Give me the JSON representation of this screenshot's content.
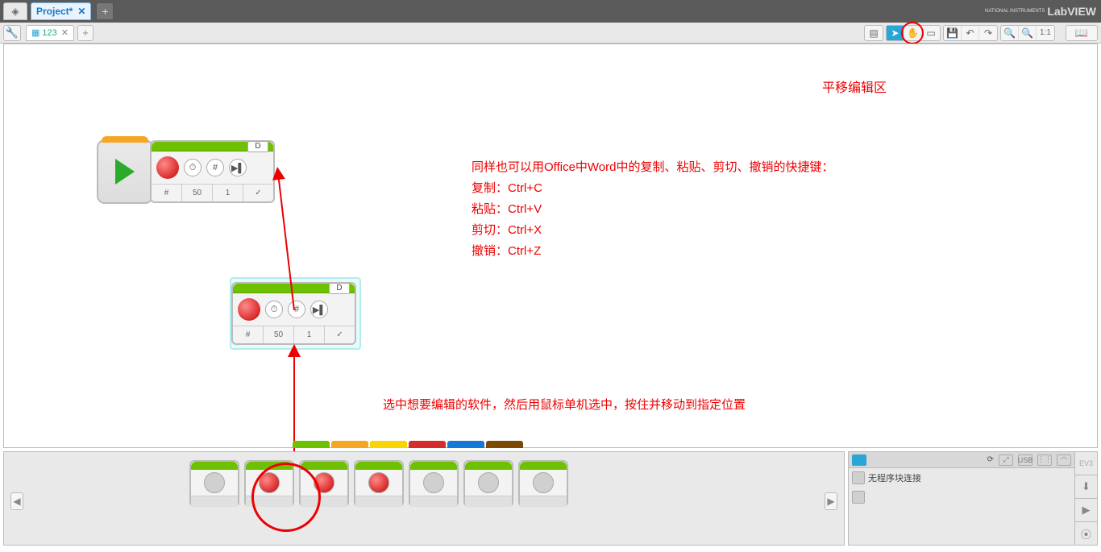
{
  "top": {
    "project_tab": "Project*",
    "brand_small": "NATIONAL INSTRUMENTS",
    "brand": "LabVIEW"
  },
  "toolbar": {
    "file_tab": "123",
    "ratio": "1:1"
  },
  "block_main": {
    "port": "D",
    "v1": "50",
    "v2": "1"
  },
  "block_sel": {
    "port": "D",
    "v1": "50",
    "v2": "1"
  },
  "annotations": {
    "pan_label": "平移编辑区",
    "shortcuts": "同样也可以用Office中Word中的复制、粘贴、剪切、撤销的快捷键：\n复制：Ctrl+C\n粘贴：Ctrl+V\n剪切：Ctrl+X\n撤销：Ctrl+Z",
    "drag_hint": "选中想要编辑的软件，然后用鼠标单机选中，按住并移动到指定位置"
  },
  "palette_colors": [
    "#6ec100",
    "#f5a623",
    "#f8d400",
    "#d62c2c",
    "#1577d6",
    "#7c4a00"
  ],
  "status": {
    "message": "无程序块连接",
    "usb": "USB"
  }
}
